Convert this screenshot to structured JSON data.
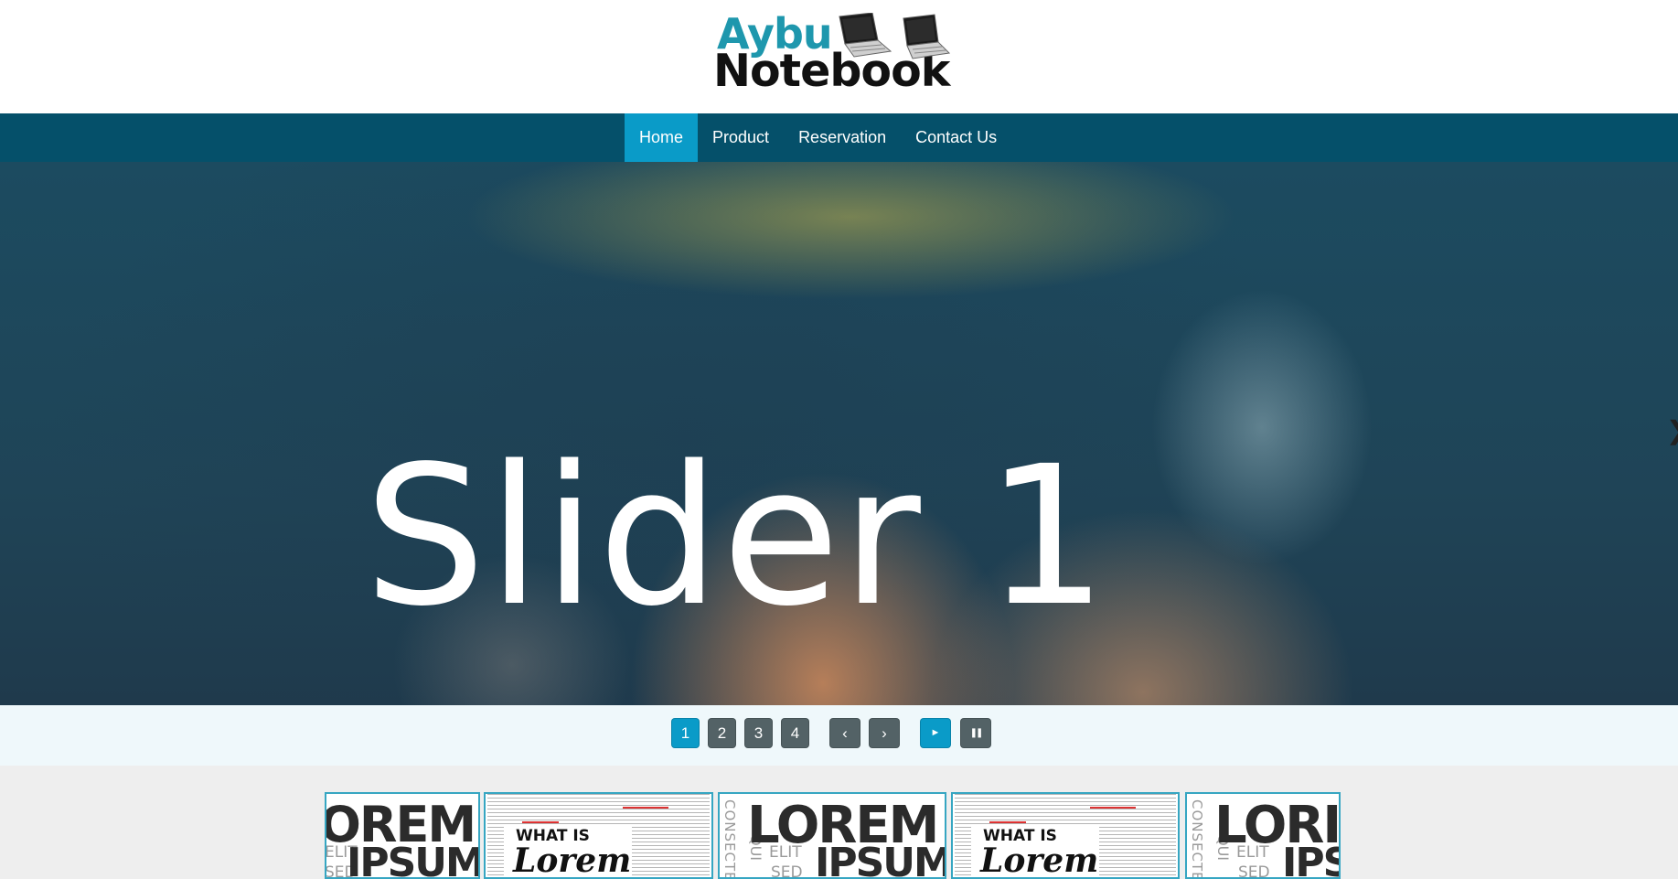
{
  "brand": {
    "line1": "Aybu",
    "line2": "Notebook",
    "colors": {
      "aybu": "#1e97ad",
      "notebook": "#111111"
    }
  },
  "nav": {
    "items": [
      {
        "label": "Home",
        "active": true
      },
      {
        "label": "Product",
        "active": false
      },
      {
        "label": "Reservation",
        "active": false
      },
      {
        "label": "Contact Us",
        "active": false
      }
    ],
    "colors": {
      "bar": "#05506a",
      "active": "#0a9bc8"
    }
  },
  "slider": {
    "title": "Slider 1",
    "next_icon": "chevron-right-icon",
    "pages": [
      "1",
      "2",
      "3",
      "4"
    ],
    "active_page": "1",
    "prev_label": "‹",
    "next_label": "›",
    "play_label": "►",
    "pause_label": "❚❚"
  },
  "thumbnails": [
    {
      "type": "lorem-ipsum",
      "big1": "OREM",
      "big2": "IPSUM",
      "side1": "ELIT",
      "side2": "SED"
    },
    {
      "type": "what-is",
      "what": "WHAT IS",
      "lorem": "Lorem"
    },
    {
      "type": "lorem-ipsum",
      "big1": "LOREM",
      "big2": "IPSUM",
      "side1": "ELIT",
      "side2": "SED",
      "side3": "QUI",
      "vertical": "CONSECTE"
    },
    {
      "type": "what-is",
      "what": "WHAT IS",
      "lorem": "Lorem"
    },
    {
      "type": "lorem-ipsum",
      "big1": "LORI",
      "big2": "IPS",
      "side1": "ELIT",
      "side2": "SED",
      "side3": "QUI",
      "vertical": "CONSECTE"
    }
  ]
}
